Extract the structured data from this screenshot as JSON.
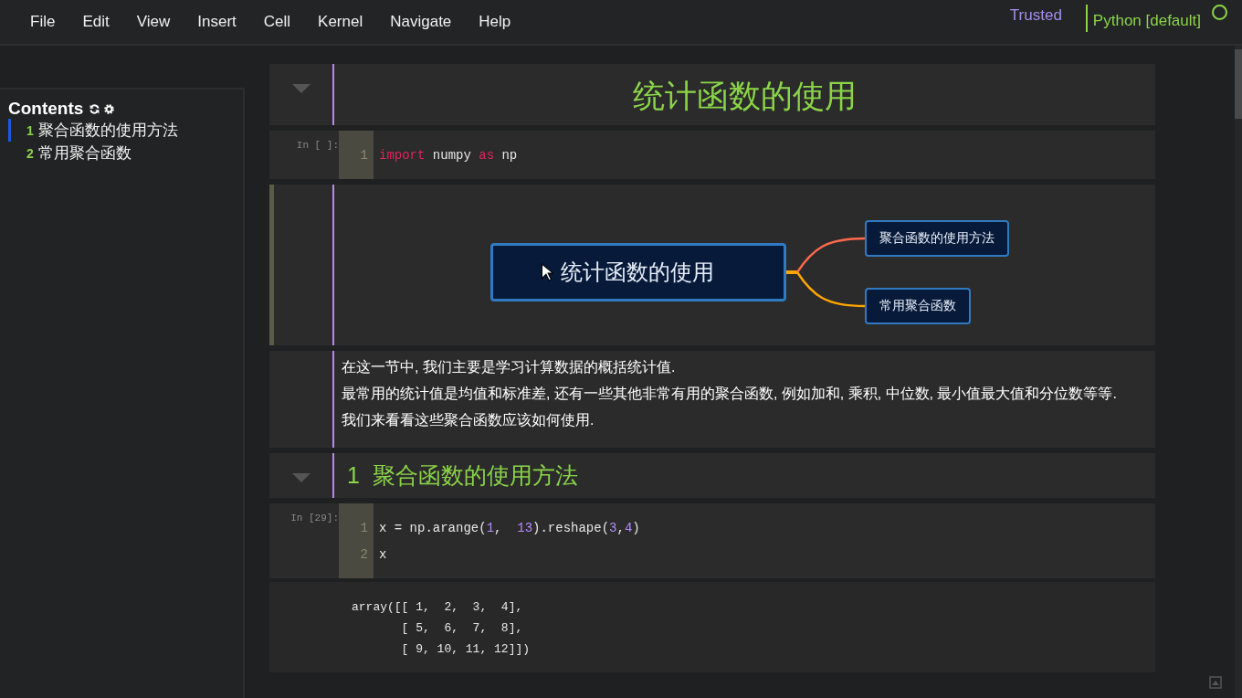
{
  "menu": [
    {
      "label": "File"
    },
    {
      "label": "Edit"
    },
    {
      "label": "View"
    },
    {
      "label": "Insert"
    },
    {
      "label": "Cell"
    },
    {
      "label": "Kernel"
    },
    {
      "label": "Navigate"
    },
    {
      "label": "Help"
    }
  ],
  "trusted": "Trusted",
  "kernel": "Python [default]",
  "toc": {
    "title": "Contents",
    "items": [
      {
        "number": "1",
        "label": "聚合函数的使用方法",
        "selected": true
      },
      {
        "number": "2",
        "label": "常用聚合函数",
        "selected": false
      }
    ]
  },
  "cells": [
    {
      "kind": "title",
      "text": "统计函数的使用"
    },
    {
      "kind": "code",
      "prompt": "In [ ]:",
      "lines": [
        {
          "number": "1",
          "tokens": [
            {
              "kind": "kw",
              "text": "import"
            },
            {
              "kind": "plain",
              "text": " numpy "
            },
            {
              "kind": "kw",
              "text": "as"
            },
            {
              "kind": "plain",
              "text": " np"
            }
          ]
        }
      ]
    },
    {
      "kind": "mindmap",
      "root": "统计函数的使用",
      "branches": [
        {
          "label": "聚合函数的使用方法",
          "color": "#ff6a4d"
        },
        {
          "label": "常用聚合函数",
          "color": "#ffa500"
        }
      ]
    },
    {
      "kind": "markdown",
      "paragraphs": [
        "在这一节中, 我们主要是学习计算数据的概括统计值.",
        "最常用的统计值是均值和标准差, 还有一些其他非常有用的聚合函数, 例如加和, 乘积, 中位数, 最小值最大值和分位数等等.",
        "我们来看看这些聚合函数应该如何使用."
      ]
    },
    {
      "kind": "heading",
      "number": "1",
      "text": "聚合函数的使用方法"
    },
    {
      "kind": "code",
      "prompt": "In [29]:",
      "lines": [
        {
          "number": "1",
          "tokens": [
            {
              "kind": "plain",
              "text": "x = np.arange("
            },
            {
              "kind": "num",
              "text": "1"
            },
            {
              "kind": "plain",
              "text": ",  "
            },
            {
              "kind": "num",
              "text": "13"
            },
            {
              "kind": "plain",
              "text": ").reshape("
            },
            {
              "kind": "num",
              "text": "3"
            },
            {
              "kind": "plain",
              "text": ","
            },
            {
              "kind": "num",
              "text": "4"
            },
            {
              "kind": "plain",
              "text": ")"
            }
          ]
        },
        {
          "number": "2",
          "tokens": [
            {
              "kind": "plain",
              "text": "x"
            }
          ]
        }
      ],
      "output": "array([[ 1,  2,  3,  4],\n       [ 5,  6,  7,  8],\n       [ 9, 10, 11, 12]])"
    }
  ]
}
